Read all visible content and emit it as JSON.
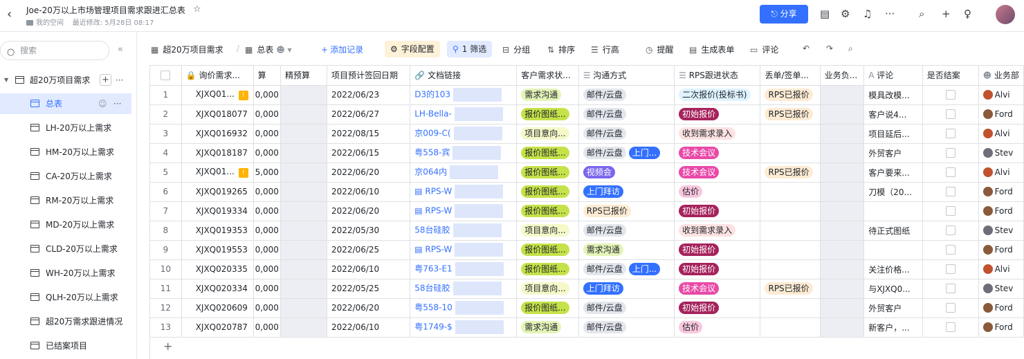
{
  "topbar": {
    "title": "Joe-20万以上市场管理项目需求跟进汇总表",
    "space": "我的空间",
    "last_modified": "最近修改: 5月28日 08:17",
    "share_label": "分享"
  },
  "sidebar": {
    "search_placeholder": "搜索",
    "root": "超20万项目需求",
    "items": [
      {
        "label": "总表"
      },
      {
        "label": "LH-20万以上需求"
      },
      {
        "label": "HM-20万以上需求"
      },
      {
        "label": "CA-20万以上需求"
      },
      {
        "label": "RM-20万以上需求"
      },
      {
        "label": "MD-20万以上需求"
      },
      {
        "label": "CLD-20万以上需求"
      },
      {
        "label": "WH-20万以上需求"
      },
      {
        "label": "QLH-20万以上需求"
      },
      {
        "label": "超20万需求跟进情况"
      },
      {
        "label": "已结案项目"
      }
    ]
  },
  "toolbar": {
    "table_name": "超20万项目需求",
    "view_name": "总表",
    "add_record": "添加记录",
    "field_config": "字段配置",
    "filter": "1 筛选",
    "group": "分组",
    "sort": "排序",
    "row_height": "行高",
    "remind": "提醒",
    "form": "生成表单",
    "comment": "评论"
  },
  "columns": [
    "询价需求...",
    "算",
    "精预算",
    "项目预计签回日期",
    "文档链接",
    "客户需求状...",
    "沟通方式",
    "RPS跟进状态",
    "丢单/签单...",
    "业务负...",
    "评论",
    "是否结案",
    "业务部"
  ],
  "rows": [
    {
      "n": "1",
      "id": "XJXQ01...",
      "warn": true,
      "amt": "0,000",
      "date": "2022/06/23",
      "doc": "D3的103",
      "docicon": false,
      "status": "需求沟通",
      "comm": [
        "邮件/云盘"
      ],
      "rps": "二次报价(投标书)",
      "lost": "RPS已报价",
      "note": "模具改模...",
      "person": "Alvi"
    },
    {
      "n": "2",
      "id": "XJXQ018077",
      "warn": false,
      "amt": "0,000",
      "date": "2022/06/27",
      "doc": "LH-Bella-",
      "docicon": false,
      "status": "报价图纸...",
      "comm": [
        "邮件/云盘"
      ],
      "rps": "初始报价",
      "lost": "RPS已报价",
      "note": "客户说4...",
      "person": "Ford"
    },
    {
      "n": "3",
      "id": "XJXQ016932",
      "warn": false,
      "amt": "0,000",
      "date": "2022/08/15",
      "doc": "京009-C(",
      "docicon": false,
      "status": "项目意向...",
      "comm": [
        "邮件/云盘"
      ],
      "rps": "收到需求录入",
      "lost": "",
      "note": "项目延后...",
      "person": "Alvi"
    },
    {
      "n": "4",
      "id": "XJXQ018187",
      "warn": false,
      "amt": "0,000",
      "date": "2022/06/15",
      "doc": "粤558-宾",
      "docicon": false,
      "status": "报价图纸...",
      "comm": [
        "邮件/云盘",
        "上门..."
      ],
      "rps": "技术会议",
      "lost": "",
      "note": "外贸客户",
      "person": "Stev"
    },
    {
      "n": "5",
      "id": "XJXQ01...",
      "warn": true,
      "amt": "5,000",
      "date": "2022/06/20",
      "doc": "京064内",
      "docicon": false,
      "status": "报价图纸...",
      "comm": [
        "视频会"
      ],
      "rps": "技术会议",
      "lost": "RPS已报价",
      "note": "客户要来...",
      "person": "Alvi"
    },
    {
      "n": "6",
      "id": "XJXQ019265",
      "warn": false,
      "amt": "0,000",
      "date": "2022/06/10",
      "doc": "RPS-W",
      "docicon": true,
      "status": "报价图纸...",
      "comm": [
        "上门拜访"
      ],
      "rps": "估价",
      "lost": "",
      "note": "刀模（20...",
      "person": "Ford"
    },
    {
      "n": "7",
      "id": "XJXQ019334",
      "warn": false,
      "amt": "0,000",
      "date": "2022/06/20",
      "doc": "RPS-W",
      "docicon": true,
      "status": "报价图纸...",
      "comm": [
        "RPS已报价"
      ],
      "rps": "初始报价",
      "lost": "",
      "note": "",
      "person": "Ford"
    },
    {
      "n": "8",
      "id": "XJXQ019353",
      "warn": false,
      "amt": "0,000",
      "date": "2022/05/30",
      "doc": "58台硅胶",
      "docicon": false,
      "status": "项目意向...",
      "comm": [
        "邮件/云盘"
      ],
      "rps": "收到需求录入",
      "lost": "",
      "note": "待正式图纸",
      "person": "Stev"
    },
    {
      "n": "9",
      "id": "XJXQ019553",
      "warn": false,
      "amt": "0,000",
      "date": "2022/06/25",
      "doc": "RPS-W",
      "docicon": true,
      "status": "报价图纸...",
      "comm": [
        "需求沟通"
      ],
      "rps": "初始报价",
      "lost": "",
      "note": "",
      "person": "Ford"
    },
    {
      "n": "10",
      "id": "XJXQ020335",
      "warn": false,
      "amt": "0,000",
      "date": "2022/06/10",
      "doc": "粤763-E1",
      "docicon": false,
      "status": "报价图纸...",
      "comm": [
        "邮件/云盘",
        "上门..."
      ],
      "rps": "初始报价",
      "lost": "",
      "note": "关注价格...",
      "person": "Alvi"
    },
    {
      "n": "11",
      "id": "XJXQ020334",
      "warn": false,
      "amt": "0,000",
      "date": "2022/05/25",
      "doc": "58台硅胶",
      "docicon": false,
      "status": "项目意向...",
      "comm": [
        "上门拜访"
      ],
      "rps": "技术会议",
      "lost": "RPS已报价",
      "note": "与XJXQ0...",
      "person": "Stev"
    },
    {
      "n": "12",
      "id": "XJXQ020609",
      "warn": false,
      "amt": "0,000",
      "date": "2022/06/20",
      "doc": "粤558-10",
      "docicon": false,
      "status": "报价图纸...",
      "comm": [
        "邮件/云盘"
      ],
      "rps": "初始报价",
      "lost": "",
      "note": "外贸客户",
      "person": "Ford"
    },
    {
      "n": "13",
      "id": "XJXQ020787",
      "warn": false,
      "amt": "0,000",
      "date": "2022/06/10",
      "doc": "粤1749-$",
      "docicon": false,
      "status": "需求沟通",
      "comm": [
        "邮件/云盘"
      ],
      "rps": "估价",
      "lost": "",
      "note": "新客户，...",
      "person": "Ford"
    }
  ],
  "tag_colors": {
    "需求沟通": "#e4f4b8",
    "报价图纸...": "#c5e24a",
    "项目意向...": "#f5f9c9",
    "邮件/云盘": "#e3e6ec",
    "上门...": "#3370ff",
    "视频会": "#7b67ee",
    "上门拜访": "#3370ff",
    "RPS已报价": "#fdebd3",
    "二次报价(投标书)": "#dff3ff",
    "初始报价": "#a5235c",
    "收到需求录入": "#fde2e2",
    "技术会议": "#e94aa8",
    "估价": "#f9c7de"
  }
}
